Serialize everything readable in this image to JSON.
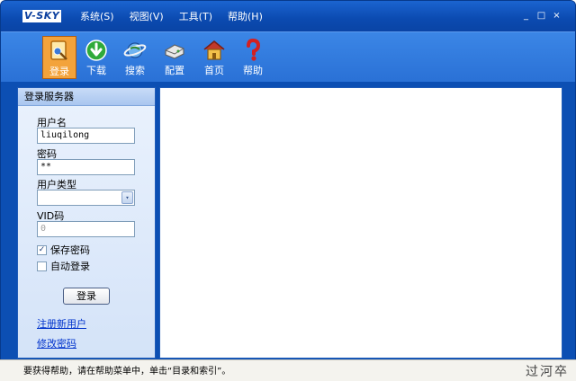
{
  "app": {
    "logo": "V-SKY"
  },
  "menu": [
    {
      "label": "系统(S)"
    },
    {
      "label": "视图(V)"
    },
    {
      "label": "工具(T)"
    },
    {
      "label": "帮助(H)"
    }
  ],
  "window_controls": {
    "minimize": "_",
    "maximize": "□",
    "close": "×"
  },
  "toolbar": [
    {
      "label": "登录",
      "icon": "login-icon",
      "active": true
    },
    {
      "label": "下载",
      "icon": "download-icon"
    },
    {
      "label": "搜索",
      "icon": "search-globe-icon"
    },
    {
      "label": "配置",
      "icon": "config-icon"
    },
    {
      "label": "首页",
      "icon": "home-icon"
    },
    {
      "label": "帮助",
      "icon": "help-icon"
    }
  ],
  "login_panel": {
    "title": "登录服务器",
    "username_label": "用户名",
    "username_value": "liuqilong",
    "password_label": "密码",
    "password_value": "**",
    "usertype_label": "用户类型",
    "usertype_value": "",
    "vid_label": "VID码",
    "vid_value": "0",
    "save_password_label": "保存密码",
    "save_password_checked": true,
    "auto_login_label": "自动登录",
    "auto_login_checked": false,
    "login_button": "登录",
    "register_link": "注册新用户",
    "change_password_link": "修改密码"
  },
  "statusbar": {
    "text": "要获得帮助，请在帮助菜单中，单击“目录和索引”。",
    "watermark": "过河卒"
  },
  "colors": {
    "frame": "#0c4fb3",
    "toolbar": "#2a71d6",
    "active_tool": "#f3a33b",
    "panel": "#dbe7f9",
    "link": "#0033cc"
  }
}
